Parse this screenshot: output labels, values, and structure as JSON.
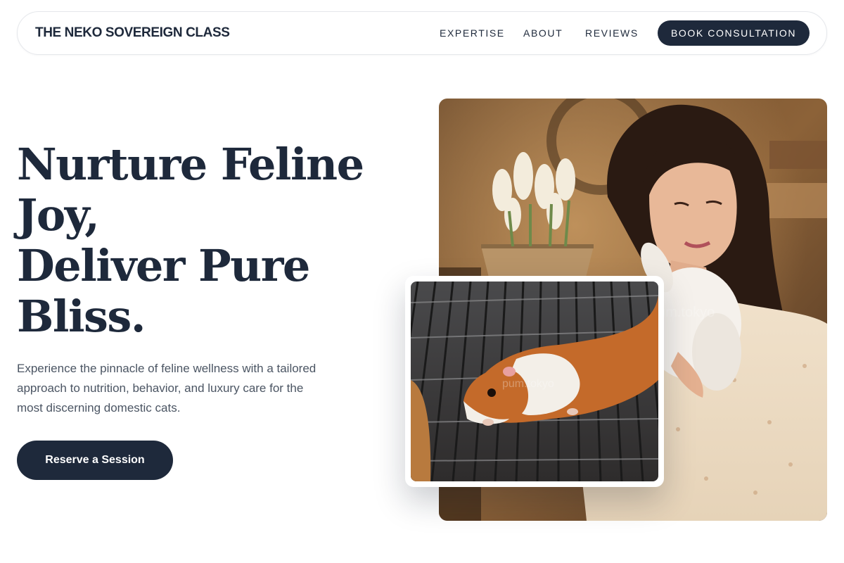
{
  "nav": {
    "brand": "THE NEKO SOVEREIGN CLASS",
    "links": [
      "EXPERTISE",
      "ABOUT",
      "REVIEWS"
    ],
    "cta": "BOOK CONSULTATION"
  },
  "hero": {
    "title_lines": [
      "Nurture Feline",
      "Joy,",
      "Deliver Pure",
      "Bliss."
    ],
    "description": "Experience the pinnacle of feline wellness with a tailored approach to nutrition, behavior, and luxury care for the most discerning domestic cats.",
    "cta": "Reserve a Session"
  },
  "images": {
    "main": "woman-holding-white-rabbit-photo",
    "secondary": "guinea-pig-on-wire-grate-photo",
    "watermark": "pum.tokyo"
  },
  "colors": {
    "primary": "#1e293b",
    "text_muted": "#4b5563",
    "border": "#e5e7eb",
    "background": "#ffffff"
  }
}
